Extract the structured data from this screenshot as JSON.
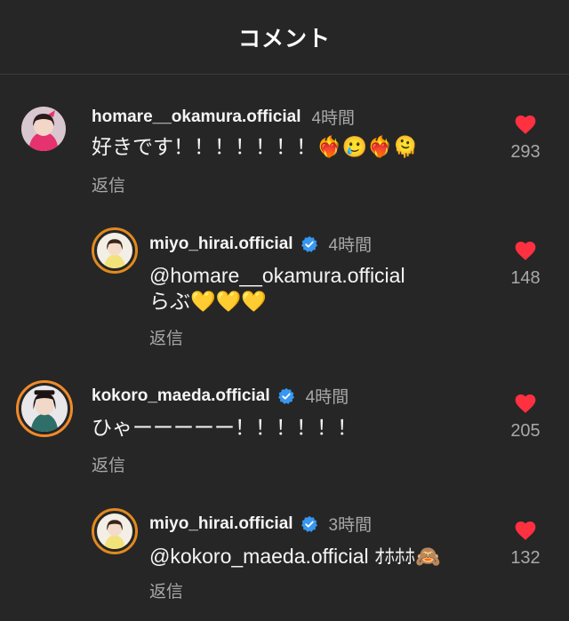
{
  "header": {
    "title": "コメント"
  },
  "colors": {
    "background": "#262626",
    "like_heart": "#ff3040",
    "verified": "#3897f0",
    "muted_text": "#a8a8a8"
  },
  "comments": [
    {
      "username": "homare__okamura.official",
      "verified": false,
      "time": "4時間",
      "text": "好きです！！！！！！！❤️‍🔥🥲❤️‍🔥🫠",
      "reply_label": "返信",
      "likes": "293"
    },
    {
      "username": "miyo_hirai.official",
      "verified": true,
      "time": "4時間",
      "text_line1": "@homare__okamura.official",
      "text_line2": "らぶ💛💛💛",
      "reply_label": "返信",
      "likes": "148"
    },
    {
      "username": "kokoro_maeda.official",
      "verified": true,
      "time": "4時間",
      "text": "ひゃーーーーー！！！！！！",
      "reply_label": "返信",
      "likes": "205"
    },
    {
      "username": "miyo_hirai.official",
      "verified": true,
      "time": "3時間",
      "text": "@kokoro_maeda.official ｵﾎﾎﾎ🙈",
      "reply_label": "返信",
      "likes": "132"
    }
  ]
}
